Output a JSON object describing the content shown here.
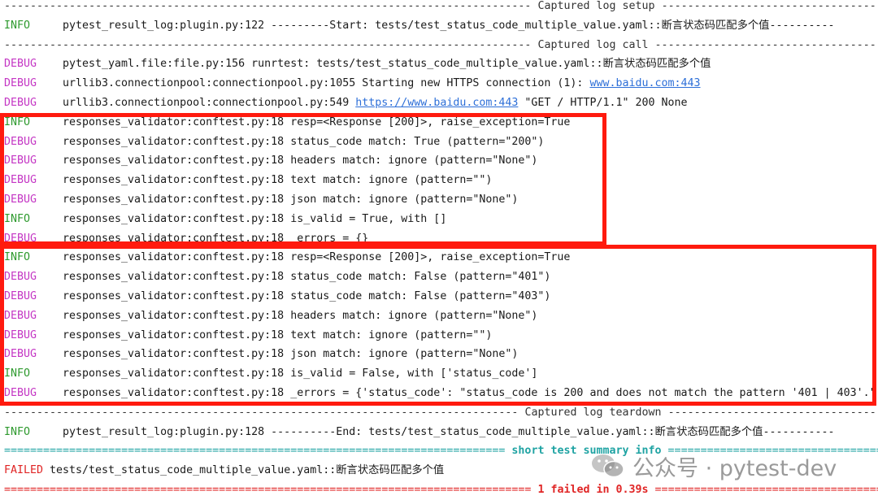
{
  "colors": {
    "info": "#2f9a2f",
    "debug": "#c436c4",
    "failed": "#e02525",
    "link": "#2d6fd8",
    "summary": "#1fa3a3",
    "highlight_box": "#ff1a0e"
  },
  "lines": [
    {
      "kind": "sep",
      "style": "gray",
      "title": "Captured log setup",
      "lead": 81
    },
    {
      "kind": "log",
      "level": "INFO",
      "parts": [
        {
          "t": "pytest_result_log:plugin.py:122 ---------Start: tests/test_status_code_multiple_value.yaml::断言状态码匹配多个值----------"
        }
      ]
    },
    {
      "kind": "sep",
      "style": "gray",
      "title": "Captured log call",
      "lead": 81
    },
    {
      "kind": "log",
      "level": "DEBUG",
      "parts": [
        {
          "t": "pytest_yaml.file:file.py:156 runrtest: tests/test_status_code_multiple_value.yaml::断言状态码匹配多个值"
        }
      ]
    },
    {
      "kind": "log",
      "level": "DEBUG",
      "parts": [
        {
          "t": "urllib3.connectionpool:connectionpool.py:1055 Starting new HTTPS connection (1): "
        },
        {
          "t": "www.baidu.com:443",
          "link": true
        }
      ]
    },
    {
      "kind": "log",
      "level": "DEBUG",
      "parts": [
        {
          "t": "urllib3.connectionpool:connectionpool.py:549 "
        },
        {
          "t": "https://www.baidu.com:443",
          "link": true
        },
        {
          "t": " \"GET / HTTP/1.1\" 200 None"
        }
      ]
    },
    {
      "kind": "log",
      "level": "INFO",
      "parts": [
        {
          "t": "responses_validator:conftest.py:18 resp=<Response [200]>, raise_exception=True"
        }
      ]
    },
    {
      "kind": "log",
      "level": "DEBUG",
      "parts": [
        {
          "t": "responses_validator:conftest.py:18 status_code match: True (pattern=\"200\")"
        }
      ]
    },
    {
      "kind": "log",
      "level": "DEBUG",
      "parts": [
        {
          "t": "responses_validator:conftest.py:18 headers match: ignore (pattern=\"None\")"
        }
      ]
    },
    {
      "kind": "log",
      "level": "DEBUG",
      "parts": [
        {
          "t": "responses_validator:conftest.py:18 text match: ignore (pattern=\"\")"
        }
      ]
    },
    {
      "kind": "log",
      "level": "DEBUG",
      "parts": [
        {
          "t": "responses_validator:conftest.py:18 json match: ignore (pattern=\"None\")"
        }
      ]
    },
    {
      "kind": "log",
      "level": "INFO",
      "parts": [
        {
          "t": "responses_validator:conftest.py:18 is_valid = True, with []"
        }
      ]
    },
    {
      "kind": "log",
      "level": "DEBUG",
      "parts": [
        {
          "t": "responses_validator:conftest.py:18 _errors = {}"
        }
      ]
    },
    {
      "kind": "log",
      "level": "INFO",
      "parts": [
        {
          "t": "responses_validator:conftest.py:18 resp=<Response [200]>, raise_exception=True"
        }
      ]
    },
    {
      "kind": "log",
      "level": "DEBUG",
      "parts": [
        {
          "t": "responses_validator:conftest.py:18 status_code match: False (pattern=\"401\")"
        }
      ]
    },
    {
      "kind": "log",
      "level": "DEBUG",
      "parts": [
        {
          "t": "responses_validator:conftest.py:18 status_code match: False (pattern=\"403\")"
        }
      ]
    },
    {
      "kind": "log",
      "level": "DEBUG",
      "parts": [
        {
          "t": "responses_validator:conftest.py:18 headers match: ignore (pattern=\"None\")"
        }
      ]
    },
    {
      "kind": "log",
      "level": "DEBUG",
      "parts": [
        {
          "t": "responses_validator:conftest.py:18 text match: ignore (pattern=\"\")"
        }
      ]
    },
    {
      "kind": "log",
      "level": "DEBUG",
      "parts": [
        {
          "t": "responses_validator:conftest.py:18 json match: ignore (pattern=\"None\")"
        }
      ]
    },
    {
      "kind": "log",
      "level": "INFO",
      "parts": [
        {
          "t": "responses_validator:conftest.py:18 is_valid = False, with ['status_code']"
        }
      ]
    },
    {
      "kind": "log",
      "level": "DEBUG",
      "parts": [
        {
          "t": "responses_validator:conftest.py:18 _errors = {'status_code': \"status_code is 200 and does not match the pattern '401 | 403'.\""
        }
      ]
    },
    {
      "kind": "sep",
      "style": "gray",
      "title": "Captured log teardown",
      "lead": 79
    },
    {
      "kind": "log",
      "level": "INFO",
      "parts": [
        {
          "t": "pytest_result_log:plugin.py:128 ----------End: tests/test_status_code_multiple_value.yaml::断言状态码匹配多个值-----------"
        }
      ]
    },
    {
      "kind": "sep",
      "style": "teal",
      "char": "=",
      "title": "short test summary info",
      "lead": 77
    },
    {
      "kind": "failed",
      "level": "FAILED",
      "text": "tests/test_status_code_multiple_value.yaml::断言状态码匹配多个值"
    },
    {
      "kind": "sep",
      "style": "red",
      "char": "=",
      "title": "1 failed in 0.39s",
      "lead": 81
    }
  ],
  "watermark": {
    "text": "公众号 · pytest-dev",
    "icon": "wechat-icon"
  }
}
